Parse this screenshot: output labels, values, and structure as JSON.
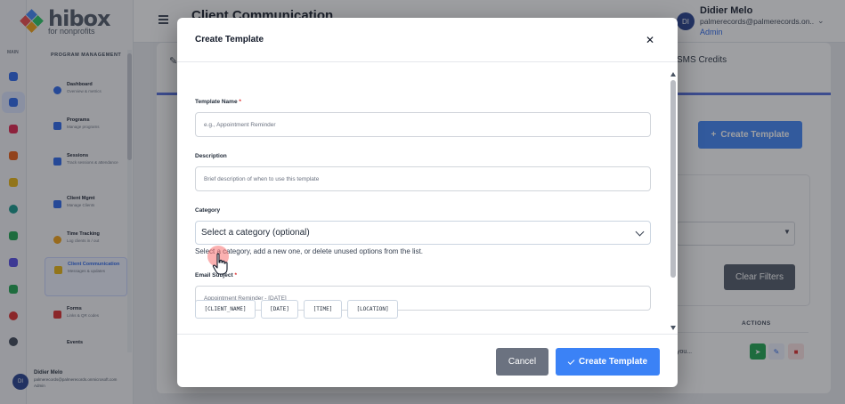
{
  "sidebar": {
    "logo_word": "hibox",
    "logo_sub": "for nonprofits",
    "main_label": "MAIN",
    "section_label": "PROGRAM MANAGEMENT",
    "items": [
      {
        "title": "Dashboard",
        "sub": "Overview & metrics",
        "icon": "dashboard-icon"
      },
      {
        "title": "Programs",
        "sub": "Manage programs",
        "icon": "programs-icon"
      },
      {
        "title": "Sessions",
        "sub": "Track sessions & attendance",
        "icon": "sessions-icon"
      },
      {
        "title": "Client Mgmt",
        "sub": "Manage Clients",
        "icon": "clients-icon"
      },
      {
        "title": "Time Tracking",
        "sub": "Log clients in / out",
        "icon": "clock-icon"
      },
      {
        "title": "Client Communication",
        "sub": "Messages & updates",
        "icon": "chat-icon"
      },
      {
        "title": "Forms",
        "sub": "Links & QR codes",
        "icon": "forms-icon"
      },
      {
        "title": "Events",
        "sub": "",
        "icon": "events-icon"
      }
    ],
    "user": {
      "initials": "DI",
      "name": "Didier Melo",
      "email": "palmerecords@palmerecords.onmicrosoft.com",
      "role": "Admin"
    }
  },
  "rail": {
    "icons": [
      "home-icon",
      "sitemap-icon",
      "handshake-icon",
      "document-icon",
      "coins-icon",
      "globe-icon",
      "network-icon",
      "report-icon",
      "users-icon",
      "pie-chart-icon",
      "settings-icon"
    ],
    "colors": [
      "#2563eb",
      "#2563eb",
      "#e11d48",
      "#ea580c",
      "#eab308",
      "#0d9488",
      "#16a34a",
      "#4f46e5",
      "#16a34a",
      "#dc2626",
      "#374151"
    ]
  },
  "topbar": {
    "page_title": "Client Communication",
    "user_initials": "DI",
    "user_name": "Didier Melo",
    "user_email": "palmerecords@palmerecords.on...",
    "user_role": "Admin"
  },
  "background": {
    "tab_sms": "SMS Credits",
    "create_button": "Create Template",
    "clear_filters": "Clear Filters",
    "actions_header": "ACTIONS",
    "cell_text": "you..."
  },
  "modal": {
    "title": "Create Template",
    "template_name_label": "Template Name",
    "template_name_placeholder": "e.g., Appointment Reminder",
    "description_label": "Description",
    "description_placeholder": "Brief description of when to use this template",
    "category_label": "Category",
    "category_value": "Select a category (optional)",
    "category_help": "Select a category, add a new one, or delete unused options from the list.",
    "subject_label": "Email Subject",
    "subject_placeholder": "Appointment Reminder - [DATE]",
    "required_mark": "*",
    "chips": [
      "[CLIENT_NAME]",
      "[DATE]",
      "[TIME]",
      "[LOCATION]"
    ],
    "cancel_label": "Cancel",
    "create_label": "Create Template"
  },
  "colors": {
    "accent": "#3b82f6",
    "cancel": "#6b7280",
    "required": "#dc2626"
  }
}
